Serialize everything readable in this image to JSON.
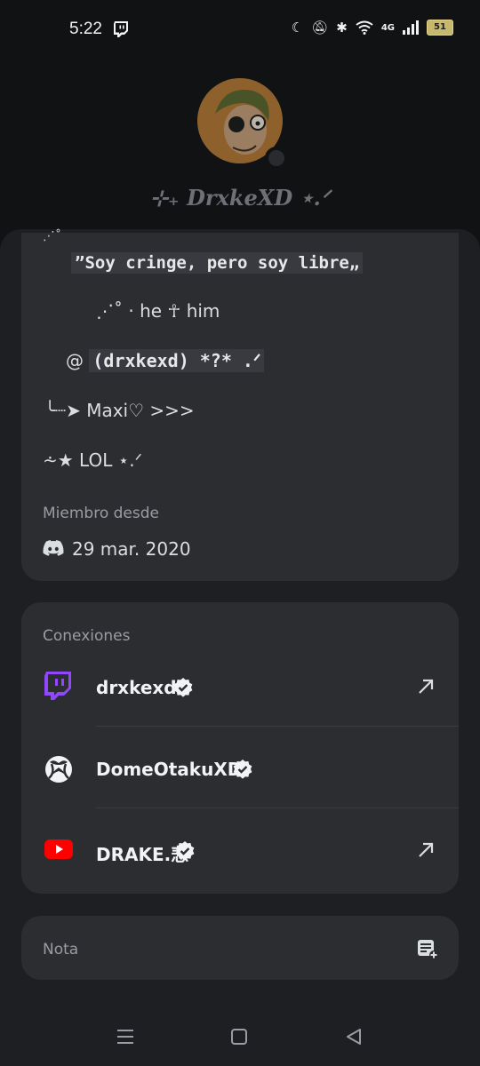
{
  "status_bar": {
    "time": "5:22",
    "battery": "51",
    "network": "4G"
  },
  "profile": {
    "display_name": "⊹₊ DrxkeXD ⋆.ᐟ",
    "sparkle": "⋰˚"
  },
  "bio": {
    "quote": "”Soy cringe, pero soy libre„",
    "pronouns": "⋰˚ · he ☥ him",
    "handle_at": "@",
    "handle_code": "(drxkexd) *?* .ᐟ",
    "line_maxi": "╰┈➤ Maxi♡ >>>",
    "line_lol": "⩪★ LOL ⋆.ᐟ"
  },
  "member_since": {
    "label": "Miembro desde",
    "date": "29 mar. 2020"
  },
  "connections": {
    "title": "Conexiones",
    "items": [
      {
        "name": "drxkexd",
        "service": "twitch-icon",
        "verified": true,
        "external": true
      },
      {
        "name": "DomeOtakuXD",
        "service": "xbox-icon",
        "verified": true,
        "external": false
      },
      {
        "name": "DRAKE.悲",
        "service": "youtube-icon",
        "verified": true,
        "external": true
      }
    ]
  },
  "note": {
    "label": "Nota"
  },
  "colors": {
    "twitch": "#9146ff",
    "youtube": "#ff0000",
    "card": "#2b2d31",
    "sheet": "#1e1f22"
  }
}
